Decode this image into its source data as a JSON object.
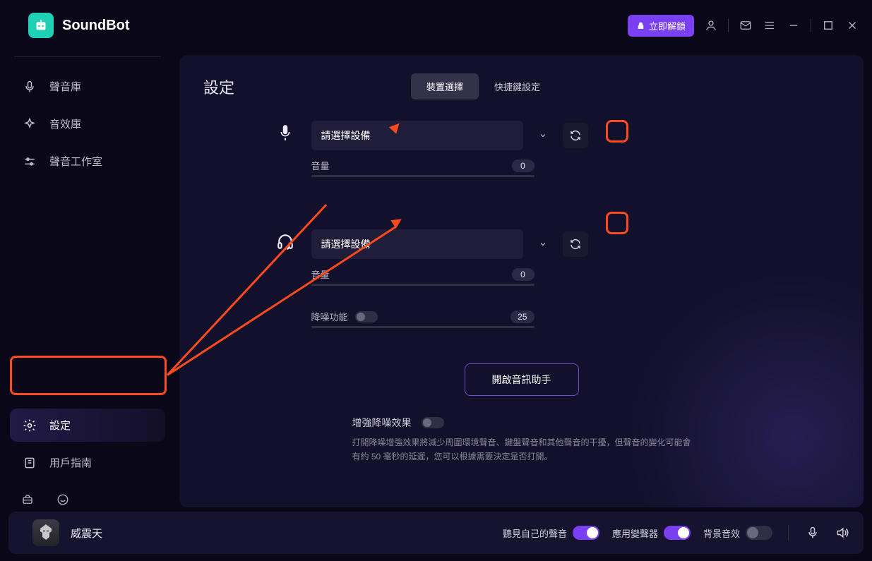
{
  "app": {
    "name": "SoundBot"
  },
  "header": {
    "unlock_label": "立即解鎖"
  },
  "sidebar": {
    "items": [
      {
        "label": "聲音庫",
        "icon": "mic"
      },
      {
        "label": "音效庫",
        "icon": "sparkle"
      },
      {
        "label": "聲音工作室",
        "icon": "sliders"
      }
    ],
    "bottom": [
      {
        "label": "設定",
        "icon": "gear",
        "active": true
      },
      {
        "label": "用戶指南",
        "icon": "book"
      }
    ]
  },
  "page": {
    "title": "設定",
    "tabs": [
      {
        "label": "裝置選擇",
        "active": true
      },
      {
        "label": "快捷鍵設定",
        "active": false
      }
    ],
    "mic": {
      "placeholder": "請選擇設備",
      "volume_label": "音量",
      "volume_value": "0"
    },
    "headphone": {
      "placeholder": "請選擇設備",
      "volume_label": "音量",
      "volume_value": "0",
      "noise_label": "降噪功能",
      "noise_value": "25"
    },
    "audio_assist_button": "開啟音訊助手",
    "enhance": {
      "title": "增強降噪效果",
      "desc": "打開降噪增強效果將減少周圍環境聲音、鍵盤聲音和其他聲音的干擾，但聲音的變化可能會有約 50 毫秒的延遲，您可以根據需要決定是否打開。"
    }
  },
  "footer": {
    "voice_name": "威震天",
    "hear_self": "聽見自己的聲音",
    "apply_changer": "應用變聲器",
    "bg_sound": "背景音效"
  }
}
